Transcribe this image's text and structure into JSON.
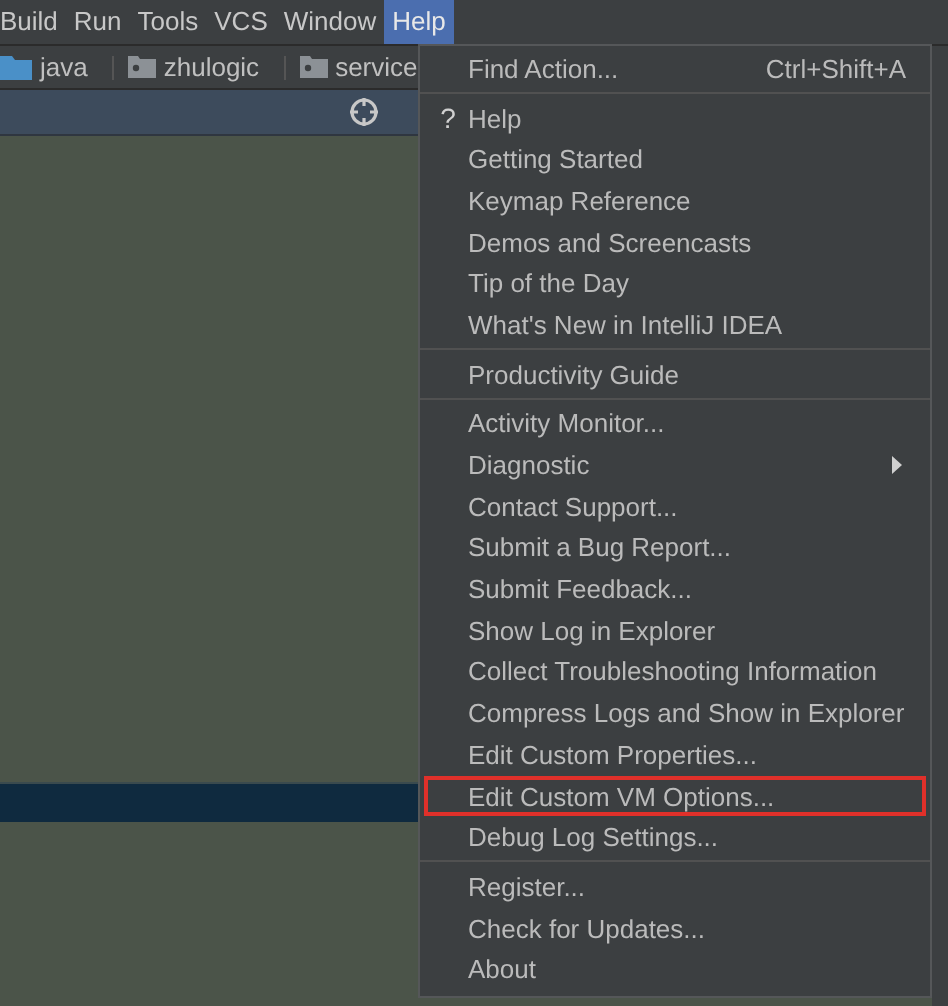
{
  "menubar": [
    {
      "label": "Build",
      "selected": false
    },
    {
      "label": "Run",
      "selected": false
    },
    {
      "label": "Tools",
      "selected": false
    },
    {
      "label": "VCS",
      "selected": false
    },
    {
      "label": "Window",
      "selected": false
    },
    {
      "label": "Help",
      "selected": true
    }
  ],
  "breadcrumbs": [
    {
      "label": "java",
      "kind": "source"
    },
    {
      "label": "zhulogic",
      "kind": "package"
    },
    {
      "label": "service",
      "kind": "package"
    }
  ],
  "menu": {
    "groups": [
      [
        {
          "label": "Find Action...",
          "shortcut": "Ctrl+Shift+A",
          "annotated": false
        }
      ],
      [
        {
          "label": "Help",
          "icon": "?",
          "annotated": false
        },
        {
          "label": "Getting Started",
          "annotated": false
        },
        {
          "label": "Keymap Reference",
          "annotated": false
        },
        {
          "label": "Demos and Screencasts",
          "annotated": false
        },
        {
          "label": "Tip of the Day",
          "annotated": false
        },
        {
          "label": "What's New in IntelliJ IDEA",
          "annotated": false
        }
      ],
      [
        {
          "label": "Productivity Guide",
          "annotated": false
        }
      ],
      [
        {
          "label": "Activity Monitor...",
          "annotated": false
        },
        {
          "label": "Diagnostic",
          "submenu": true,
          "annotated": false
        },
        {
          "label": "Contact Support...",
          "annotated": false
        },
        {
          "label": "Submit a Bug Report...",
          "annotated": false
        },
        {
          "label": "Submit Feedback...",
          "annotated": false
        },
        {
          "label": "Show Log in Explorer",
          "annotated": false
        },
        {
          "label": "Collect Troubleshooting Information",
          "annotated": false
        },
        {
          "label": "Compress Logs and Show in Explorer",
          "annotated": false
        },
        {
          "label": "Edit Custom Properties...",
          "annotated": false
        },
        {
          "label": "Edit Custom VM Options...",
          "annotated": true
        },
        {
          "label": "Debug Log Settings...",
          "annotated": false
        }
      ],
      [
        {
          "label": "Register...",
          "annotated": false
        },
        {
          "label": "Check for Updates...",
          "annotated": false
        },
        {
          "label": "About",
          "annotated": false
        }
      ]
    ]
  }
}
